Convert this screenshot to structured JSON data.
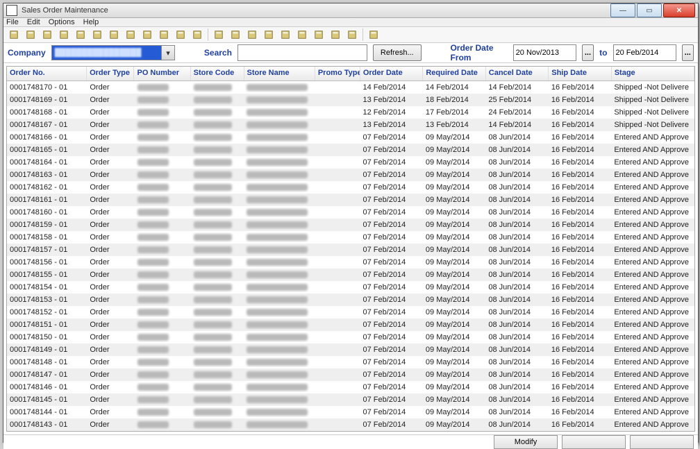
{
  "window": {
    "title": "Sales Order Maintenance"
  },
  "menus": [
    "File",
    "Edit",
    "Options",
    "Help"
  ],
  "toolbar_icons": [
    "folder-icon",
    "open-icon",
    "save-icon",
    "cut-icon",
    "print-icon",
    "new-icon",
    "copy-icon",
    "paste-icon",
    "refresh-icon",
    "grid-icon",
    "list-icon",
    "filter-icon",
    "sep",
    "clipboard-icon",
    "apps-icon",
    "target-icon",
    "user-icon",
    "doc-icon",
    "card-icon",
    "export-icon",
    "table-icon",
    "lock-icon",
    "sep",
    "calendar-icon"
  ],
  "filter": {
    "company_label": "Company",
    "company_value": "████████████████",
    "search_label": "Search",
    "search_value": "",
    "refresh_label": "Refresh...",
    "date_label": "Order Date From",
    "date_from": "20 Nov/2013",
    "date_to_label": "to",
    "date_to": "20 Feb/2014",
    "date_btn": "..."
  },
  "columns": [
    "Order No.",
    "Order Type",
    "PO Number",
    "Store Code",
    "Store Name",
    "Promo Type",
    "Order Date",
    "Required Date",
    "Cancel Date",
    "Ship Date",
    "Stage"
  ],
  "rows": [
    {
      "no": "0001748170 - 01",
      "type": "Order",
      "order": "14 Feb/2014",
      "req": "14 Feb/2014",
      "cancel": "14 Feb/2014",
      "ship": "16 Feb/2014",
      "stage": "Shipped -Not Delivere"
    },
    {
      "no": "0001748169 - 01",
      "type": "Order",
      "order": "13 Feb/2014",
      "req": "18 Feb/2014",
      "cancel": "25 Feb/2014",
      "ship": "16 Feb/2014",
      "stage": "Shipped -Not Delivere"
    },
    {
      "no": "0001748168 - 01",
      "type": "Order",
      "order": "12 Feb/2014",
      "req": "17 Feb/2014",
      "cancel": "24 Feb/2014",
      "ship": "16 Feb/2014",
      "stage": "Shipped -Not Delivere"
    },
    {
      "no": "0001748167 - 01",
      "type": "Order",
      "order": "13 Feb/2014",
      "req": "13 Feb/2014",
      "cancel": "14 Feb/2014",
      "ship": "16 Feb/2014",
      "stage": "Shipped -Not Delivere"
    },
    {
      "no": "0001748166 - 01",
      "type": "Order",
      "order": "07 Feb/2014",
      "req": "09 May/2014",
      "cancel": "08 Jun/2014",
      "ship": "16 Feb/2014",
      "stage": "Entered AND Approve"
    },
    {
      "no": "0001748165 - 01",
      "type": "Order",
      "order": "07 Feb/2014",
      "req": "09 May/2014",
      "cancel": "08 Jun/2014",
      "ship": "16 Feb/2014",
      "stage": "Entered AND Approve"
    },
    {
      "no": "0001748164 - 01",
      "type": "Order",
      "order": "07 Feb/2014",
      "req": "09 May/2014",
      "cancel": "08 Jun/2014",
      "ship": "16 Feb/2014",
      "stage": "Entered AND Approve"
    },
    {
      "no": "0001748163 - 01",
      "type": "Order",
      "order": "07 Feb/2014",
      "req": "09 May/2014",
      "cancel": "08 Jun/2014",
      "ship": "16 Feb/2014",
      "stage": "Entered AND Approve"
    },
    {
      "no": "0001748162 - 01",
      "type": "Order",
      "order": "07 Feb/2014",
      "req": "09 May/2014",
      "cancel": "08 Jun/2014",
      "ship": "16 Feb/2014",
      "stage": "Entered AND Approve"
    },
    {
      "no": "0001748161 - 01",
      "type": "Order",
      "order": "07 Feb/2014",
      "req": "09 May/2014",
      "cancel": "08 Jun/2014",
      "ship": "16 Feb/2014",
      "stage": "Entered AND Approve"
    },
    {
      "no": "0001748160 - 01",
      "type": "Order",
      "order": "07 Feb/2014",
      "req": "09 May/2014",
      "cancel": "08 Jun/2014",
      "ship": "16 Feb/2014",
      "stage": "Entered AND Approve"
    },
    {
      "no": "0001748159 - 01",
      "type": "Order",
      "order": "07 Feb/2014",
      "req": "09 May/2014",
      "cancel": "08 Jun/2014",
      "ship": "16 Feb/2014",
      "stage": "Entered AND Approve"
    },
    {
      "no": "0001748158 - 01",
      "type": "Order",
      "order": "07 Feb/2014",
      "req": "09 May/2014",
      "cancel": "08 Jun/2014",
      "ship": "16 Feb/2014",
      "stage": "Entered AND Approve"
    },
    {
      "no": "0001748157 - 01",
      "type": "Order",
      "order": "07 Feb/2014",
      "req": "09 May/2014",
      "cancel": "08 Jun/2014",
      "ship": "16 Feb/2014",
      "stage": "Entered AND Approve"
    },
    {
      "no": "0001748156 - 01",
      "type": "Order",
      "order": "07 Feb/2014",
      "req": "09 May/2014",
      "cancel": "08 Jun/2014",
      "ship": "16 Feb/2014",
      "stage": "Entered AND Approve"
    },
    {
      "no": "0001748155 - 01",
      "type": "Order",
      "order": "07 Feb/2014",
      "req": "09 May/2014",
      "cancel": "08 Jun/2014",
      "ship": "16 Feb/2014",
      "stage": "Entered AND Approve"
    },
    {
      "no": "0001748154 - 01",
      "type": "Order",
      "order": "07 Feb/2014",
      "req": "09 May/2014",
      "cancel": "08 Jun/2014",
      "ship": "16 Feb/2014",
      "stage": "Entered AND Approve"
    },
    {
      "no": "0001748153 - 01",
      "type": "Order",
      "order": "07 Feb/2014",
      "req": "09 May/2014",
      "cancel": "08 Jun/2014",
      "ship": "16 Feb/2014",
      "stage": "Entered AND Approve"
    },
    {
      "no": "0001748152 - 01",
      "type": "Order",
      "order": "07 Feb/2014",
      "req": "09 May/2014",
      "cancel": "08 Jun/2014",
      "ship": "16 Feb/2014",
      "stage": "Entered AND Approve"
    },
    {
      "no": "0001748151 - 01",
      "type": "Order",
      "order": "07 Feb/2014",
      "req": "09 May/2014",
      "cancel": "08 Jun/2014",
      "ship": "16 Feb/2014",
      "stage": "Entered AND Approve"
    },
    {
      "no": "0001748150 - 01",
      "type": "Order",
      "order": "07 Feb/2014",
      "req": "09 May/2014",
      "cancel": "08 Jun/2014",
      "ship": "16 Feb/2014",
      "stage": "Entered AND Approve"
    },
    {
      "no": "0001748149 - 01",
      "type": "Order",
      "order": "07 Feb/2014",
      "req": "09 May/2014",
      "cancel": "08 Jun/2014",
      "ship": "16 Feb/2014",
      "stage": "Entered AND Approve"
    },
    {
      "no": "0001748148 - 01",
      "type": "Order",
      "order": "07 Feb/2014",
      "req": "09 May/2014",
      "cancel": "08 Jun/2014",
      "ship": "16 Feb/2014",
      "stage": "Entered AND Approve"
    },
    {
      "no": "0001748147 - 01",
      "type": "Order",
      "order": "07 Feb/2014",
      "req": "09 May/2014",
      "cancel": "08 Jun/2014",
      "ship": "16 Feb/2014",
      "stage": "Entered AND Approve"
    },
    {
      "no": "0001748146 - 01",
      "type": "Order",
      "order": "07 Feb/2014",
      "req": "09 May/2014",
      "cancel": "08 Jun/2014",
      "ship": "16 Feb/2014",
      "stage": "Entered AND Approve"
    },
    {
      "no": "0001748145 - 01",
      "type": "Order",
      "order": "07 Feb/2014",
      "req": "09 May/2014",
      "cancel": "08 Jun/2014",
      "ship": "16 Feb/2014",
      "stage": "Entered AND Approve"
    },
    {
      "no": "0001748144 - 01",
      "type": "Order",
      "order": "07 Feb/2014",
      "req": "09 May/2014",
      "cancel": "08 Jun/2014",
      "ship": "16 Feb/2014",
      "stage": "Entered AND Approve"
    },
    {
      "no": "0001748143 - 01",
      "type": "Order",
      "order": "07 Feb/2014",
      "req": "09 May/2014",
      "cancel": "08 Jun/2014",
      "ship": "16 Feb/2014",
      "stage": "Entered AND Approve"
    }
  ],
  "footer": {
    "modify": "Modify",
    "blank1": "",
    "blank2": ""
  }
}
